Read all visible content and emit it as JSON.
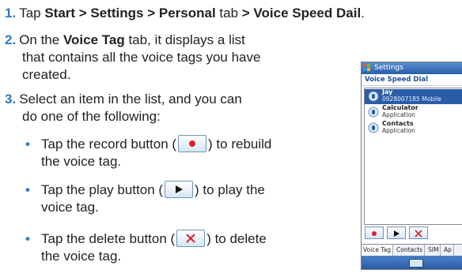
{
  "steps": [
    {
      "num": "1.",
      "pre": "Tap ",
      "bold": "Start > Settings > Personal",
      "post": " tab ",
      "bold2": "> Voice Speed Dail",
      "post2": "."
    },
    {
      "num": "2.",
      "line1_pre": "On the ",
      "line1_bold": "Voice Tag",
      "line1_post": " tab, it displays a list",
      "line2": "that contains all the voice tags you have",
      "line3": "created."
    },
    {
      "num": "3.",
      "line1": "Select an item in the list, and you can",
      "line2": "do one of the following:"
    }
  ],
  "bullets": [
    {
      "pre": "Tap the record button (",
      "post": ") to rebuild",
      "line2": "the voice tag."
    },
    {
      "pre": "Tap the play button (",
      "post": ") to play the",
      "line2": "voice tag."
    },
    {
      "pre": "Tap the delete button (",
      "post": ") to delete",
      "line2": "the voice tag."
    }
  ],
  "phone": {
    "title": "Settings",
    "subtitle": "Voice Speed Dial",
    "items": [
      {
        "name": "Jay",
        "sub": "0928007185 Mobile",
        "selected": true
      },
      {
        "name": "Calculator",
        "sub": "Application",
        "selected": false
      },
      {
        "name": "Contacts",
        "sub": "Application",
        "selected": false
      }
    ],
    "tabs": [
      "Voice Tag",
      "Contacts",
      "SIM",
      "Ap"
    ]
  },
  "colors": {
    "accent": "#2f7cc2",
    "record": "#e0202a",
    "delete": "#e0202a",
    "play": "#111111"
  },
  "icons": {
    "record": "record-icon",
    "play": "play-icon",
    "delete": "delete-icon",
    "keyboard": "keyboard-icon"
  }
}
